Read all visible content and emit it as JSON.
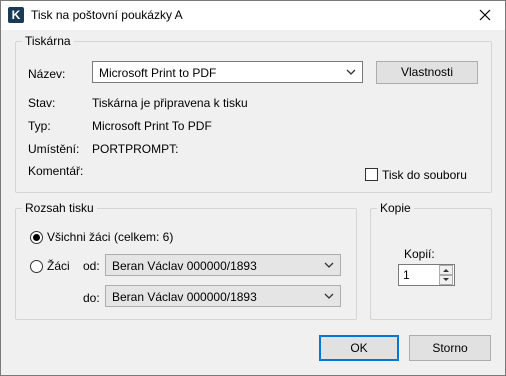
{
  "window": {
    "title": "Tisk na poštovní poukázky A",
    "icon": "app-logo-icon",
    "close_glyph": "✕"
  },
  "printer": {
    "group_label": "Tiskárna",
    "name_label": "Název:",
    "name_value": "Microsoft Print to PDF",
    "properties_button": "Vlastnosti",
    "status_label": "Stav:",
    "status_value": "Tiskárna je připravena k tisku",
    "type_label": "Typ:",
    "type_value": "Microsoft Print To PDF",
    "location_label": "Umístění:",
    "location_value": "PORTPROMPT:",
    "comment_label": "Komentář:",
    "print_to_file_label": "Tisk do souboru"
  },
  "range": {
    "group_label": "Rozsah tisku",
    "all_label": "Všichni žáci",
    "all_count": "(celkem: 6)",
    "students_label": "Žáci",
    "from_label": "od:",
    "from_value": "Beran Václav 000000/1893",
    "to_label": "do:",
    "to_value": "Beran Václav 000000/1893",
    "selected": "all"
  },
  "copies": {
    "group_label": "Kopie",
    "copies_label": "Kopií:",
    "copies_value": "1"
  },
  "buttons": {
    "ok": "OK",
    "cancel": "Storno"
  }
}
